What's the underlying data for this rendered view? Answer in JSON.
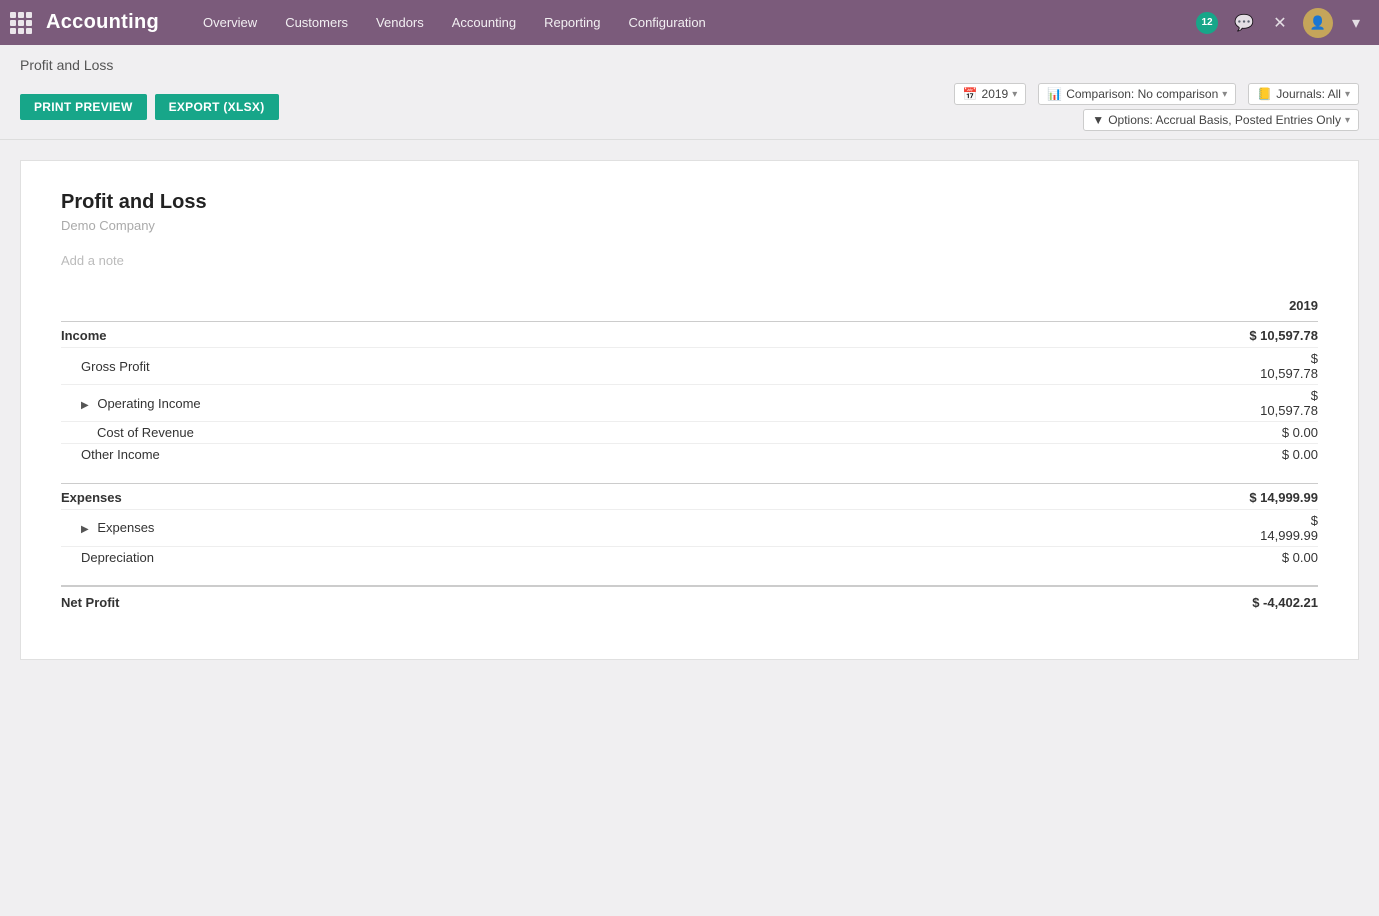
{
  "app": {
    "title": "Accounting",
    "grid_badge": "12"
  },
  "nav": {
    "items": [
      {
        "label": "Overview",
        "key": "overview"
      },
      {
        "label": "Customers",
        "key": "customers"
      },
      {
        "label": "Vendors",
        "key": "vendors"
      },
      {
        "label": "Accounting",
        "key": "accounting"
      },
      {
        "label": "Reporting",
        "key": "reporting"
      },
      {
        "label": "Configuration",
        "key": "configuration"
      }
    ]
  },
  "page": {
    "title": "Profit and Loss",
    "print_preview_label": "PRINT PREVIEW",
    "export_label": "EXPORT (XLSX)"
  },
  "filters": {
    "year_label": "2019",
    "comparison_label": "Comparison: No comparison",
    "journals_label": "Journals: All",
    "options_label": "Options: Accrual Basis, Posted Entries Only"
  },
  "report": {
    "title": "Profit and Loss",
    "subtitle": "Demo Company",
    "add_note_placeholder": "Add a note",
    "year_col": "2019",
    "sections": [
      {
        "key": "income",
        "label": "Income",
        "amount": "$ 10,597.78",
        "rows": [
          {
            "label": "Gross Profit",
            "amount": "$ 10,597.78",
            "indent": 1,
            "expandable": false
          },
          {
            "label": "Operating Income",
            "amount": "$ 10,597.78",
            "indent": 1,
            "expandable": true
          },
          {
            "label": "Cost of Revenue",
            "amount": "$ 0.00",
            "indent": 2,
            "expandable": false,
            "grey": true
          },
          {
            "label": "Other Income",
            "amount": "$ 0.00",
            "indent": 1,
            "expandable": false
          }
        ]
      },
      {
        "key": "expenses",
        "label": "Expenses",
        "amount": "$ 14,999.99",
        "rows": [
          {
            "label": "Expenses",
            "amount": "$ 14,999.99",
            "indent": 1,
            "expandable": true
          },
          {
            "label": "Depreciation",
            "amount": "$ 0.00",
            "indent": 1,
            "expandable": false
          }
        ]
      }
    ],
    "net_profit": {
      "label": "Net Profit",
      "amount": "$ -4,402.21"
    }
  }
}
